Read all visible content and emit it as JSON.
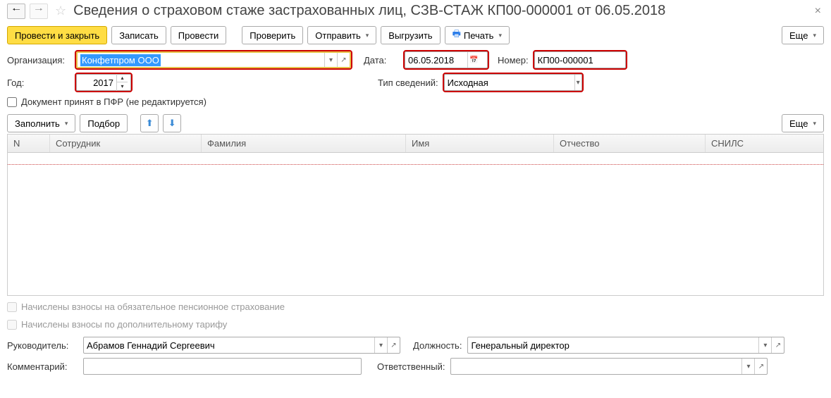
{
  "title": "Сведения о страховом стаже застрахованных лиц, СЗВ-СТАЖ КП00-000001 от 06.05.2018",
  "toolbar": {
    "post_close": "Провести и закрыть",
    "save": "Записать",
    "post": "Провести",
    "check": "Проверить",
    "send": "Отправить",
    "upload": "Выгрузить",
    "print": "Печать",
    "more": "Еще"
  },
  "fields": {
    "org_label": "Организация:",
    "org_value": "Конфетпром ООО",
    "date_label": "Дата:",
    "date_value": "06.05.2018",
    "number_label": "Номер:",
    "number_value": "КП00-000001",
    "year_label": "Год:",
    "year_value": "2017",
    "type_label": "Тип сведений:",
    "type_value": "Исходная"
  },
  "checkboxes": {
    "pfr_accepted": "Документ принят в ПФР (не редактируется)",
    "pension_contrib": "Начислены взносы на обязательное пенсионное страхование",
    "extra_tariff": "Начислены взносы по дополнительному тарифу"
  },
  "table_toolbar": {
    "fill": "Заполнить",
    "select": "Подбор",
    "more": "Еще"
  },
  "table_headers": {
    "n": "N",
    "employee": "Сотрудник",
    "lastname": "Фамилия",
    "firstname": "Имя",
    "patronymic": "Отчество",
    "snils": "СНИЛС"
  },
  "footer": {
    "manager_label": "Руководитель:",
    "manager_value": "Абрамов Геннадий Сергеевич",
    "position_label": "Должность:",
    "position_value": "Генеральный директор",
    "comment_label": "Комментарий:",
    "comment_value": "",
    "responsible_label": "Ответственный:",
    "responsible_value": ""
  }
}
